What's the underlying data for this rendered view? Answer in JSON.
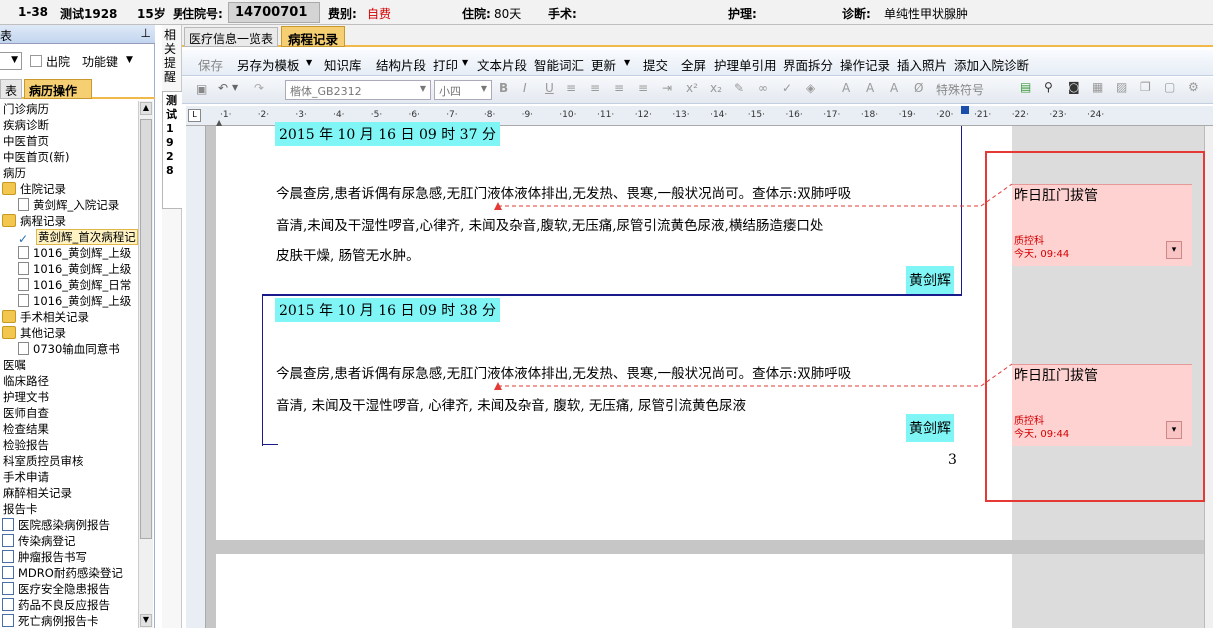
{
  "patient_header": {
    "bed": "1-38",
    "name": "测试1928",
    "age": "15岁",
    "partial": "男",
    "admission_label": "住院号:",
    "admission_no": "14700701",
    "fee_label": "费别:",
    "fee_value": "自费",
    "stay_label": "住院:",
    "stay_value": "80天",
    "surgery_label": "手术:",
    "nursing_label": "护理:",
    "diagnosis_label": "诊断:",
    "diagnosis_value": "单纯性甲状腺肿"
  },
  "left_panel": {
    "title": "表",
    "pin": "ꟸ",
    "discharged_label": "出院",
    "function_key": "功能键",
    "tab_left": "表",
    "tab_active": "病历操作",
    "tree": [
      {
        "label": "门诊病历",
        "indent": 0,
        "icon": "none"
      },
      {
        "label": "疾病诊断",
        "indent": 0,
        "icon": "none"
      },
      {
        "label": "中医首页",
        "indent": 0,
        "icon": "none"
      },
      {
        "label": "中医首页(新)",
        "indent": 0,
        "icon": "none"
      },
      {
        "label": "病历",
        "indent": 0,
        "icon": "none"
      },
      {
        "label": "住院记录",
        "indent": 0,
        "icon": "folder-icon"
      },
      {
        "label": "黄剑辉_入院记录",
        "indent": 1,
        "icon": "document-icon"
      },
      {
        "label": "病程记录",
        "indent": 0,
        "icon": "folder-icon"
      },
      {
        "label": "黄剑辉_首次病程记",
        "indent": 1,
        "icon": "check-icon",
        "selected": true
      },
      {
        "label": "1016_黄剑辉_上级",
        "indent": 1,
        "icon": "document-icon"
      },
      {
        "label": "1016_黄剑辉_上级",
        "indent": 1,
        "icon": "document-icon"
      },
      {
        "label": "1016_黄剑辉_日常",
        "indent": 1,
        "icon": "document-icon"
      },
      {
        "label": "1016_黄剑辉_上级",
        "indent": 1,
        "icon": "document-icon"
      },
      {
        "label": "手术相关记录",
        "indent": 0,
        "icon": "folder-icon"
      },
      {
        "label": "其他记录",
        "indent": 0,
        "icon": "folder-icon"
      },
      {
        "label": "0730输血同意书",
        "indent": 1,
        "icon": "document-icon"
      },
      {
        "label": "医嘱",
        "indent": 0,
        "icon": "none"
      },
      {
        "label": "临床路径",
        "indent": 0,
        "icon": "none"
      },
      {
        "label": "护理文书",
        "indent": 0,
        "icon": "none"
      },
      {
        "label": "医师自查",
        "indent": 0,
        "icon": "none"
      },
      {
        "label": "检查结果",
        "indent": 0,
        "icon": "none"
      },
      {
        "label": "检验报告",
        "indent": 0,
        "icon": "none"
      },
      {
        "label": "科室质控员审核",
        "indent": 0,
        "icon": "none"
      },
      {
        "label": "手术申请",
        "indent": 0,
        "icon": "none"
      },
      {
        "label": "麻醉相关记录",
        "indent": 0,
        "icon": "none"
      },
      {
        "label": "报告卡",
        "indent": 0,
        "icon": "none"
      },
      {
        "label": "医院感染病例报告",
        "indent": 0,
        "icon": "report-icon"
      },
      {
        "label": "传染病登记",
        "indent": 0,
        "icon": "report-icon"
      },
      {
        "label": "肿瘤报告书写",
        "indent": 0,
        "icon": "report-icon"
      },
      {
        "label": "MDRO耐药感染登记",
        "indent": 0,
        "icon": "report-icon"
      },
      {
        "label": "医疗安全隐患报告",
        "indent": 0,
        "icon": "report-icon"
      },
      {
        "label": "药品不良反应报告",
        "indent": 0,
        "icon": "report-icon"
      },
      {
        "label": "死亡病例报告卡",
        "indent": 0,
        "icon": "report-icon"
      }
    ]
  },
  "vertical_tabs": {
    "reminder": "相关提醒",
    "patient": "测试1928"
  },
  "doc_tabs": [
    {
      "label": "医疗信息一览表",
      "active": false
    },
    {
      "label": "病程记录",
      "active": true
    }
  ],
  "menu": [
    "保存",
    "另存为模板",
    "知识库",
    "结构片段",
    "打印",
    "文本片段",
    "智能词汇",
    "更新",
    "提交",
    "全屏",
    "护理单引用",
    "界面拆分",
    "操作记录",
    "插入照片",
    "添加入院诊断"
  ],
  "format_bar": {
    "font": "楷体_GB2312",
    "size": "小四",
    "special_char": "特殊符号"
  },
  "ruler": {
    "ticks": [
      "1",
      "2",
      "3",
      "4",
      "5",
      "6",
      "7",
      "8",
      "9",
      "10",
      "11",
      "12",
      "13",
      "14",
      "15",
      "16",
      "17",
      "18",
      "19",
      "20",
      "21",
      "22",
      "23",
      "24"
    ]
  },
  "document": {
    "entry1_date": "2015 年 10 月 16 日 09 时 37 分",
    "entry1_line1": "今晨查房,患者诉偶有尿急感,无肛门液体液体排出,无发热、畏寒,一般状况尚可。查体示:双肺呼吸",
    "entry1_line2": "音清,未闻及干湿性啰音,心律齐, 未闻及杂音,腹软,无压痛,尿管引流黄色尿液,横结肠造瘘口处",
    "entry1_line3": "皮肤干燥, 肠管无水肿。",
    "entry1_sign": "黄剑辉",
    "entry2_date": "2015 年 10 月 16 日 09 时 38 分",
    "entry2_line1": "今晨查房,患者诉偶有尿急感,无肛门液体液体排出,无发热、畏寒,一般状况尚可。查体示:双肺呼吸",
    "entry2_line2": "音清, 未闻及干湿性啰音, 心律齐, 未闻及杂音, 腹软, 无压痛, 尿管引流黄色尿液",
    "entry2_sign": "黄剑辉",
    "page_number": "3"
  },
  "comments": [
    {
      "title": "昨日肛门拔管",
      "dept": "质控科",
      "time": "今天, 09:44"
    },
    {
      "title": "昨日肛门拔管",
      "dept": "质控科",
      "time": "今天, 09:44"
    }
  ],
  "colors": {
    "highlight": "#7ff5f5",
    "comment_bg": "#ffd2d2",
    "annotation_red": "#e53935",
    "tab_accent": "#f0b94a"
  }
}
